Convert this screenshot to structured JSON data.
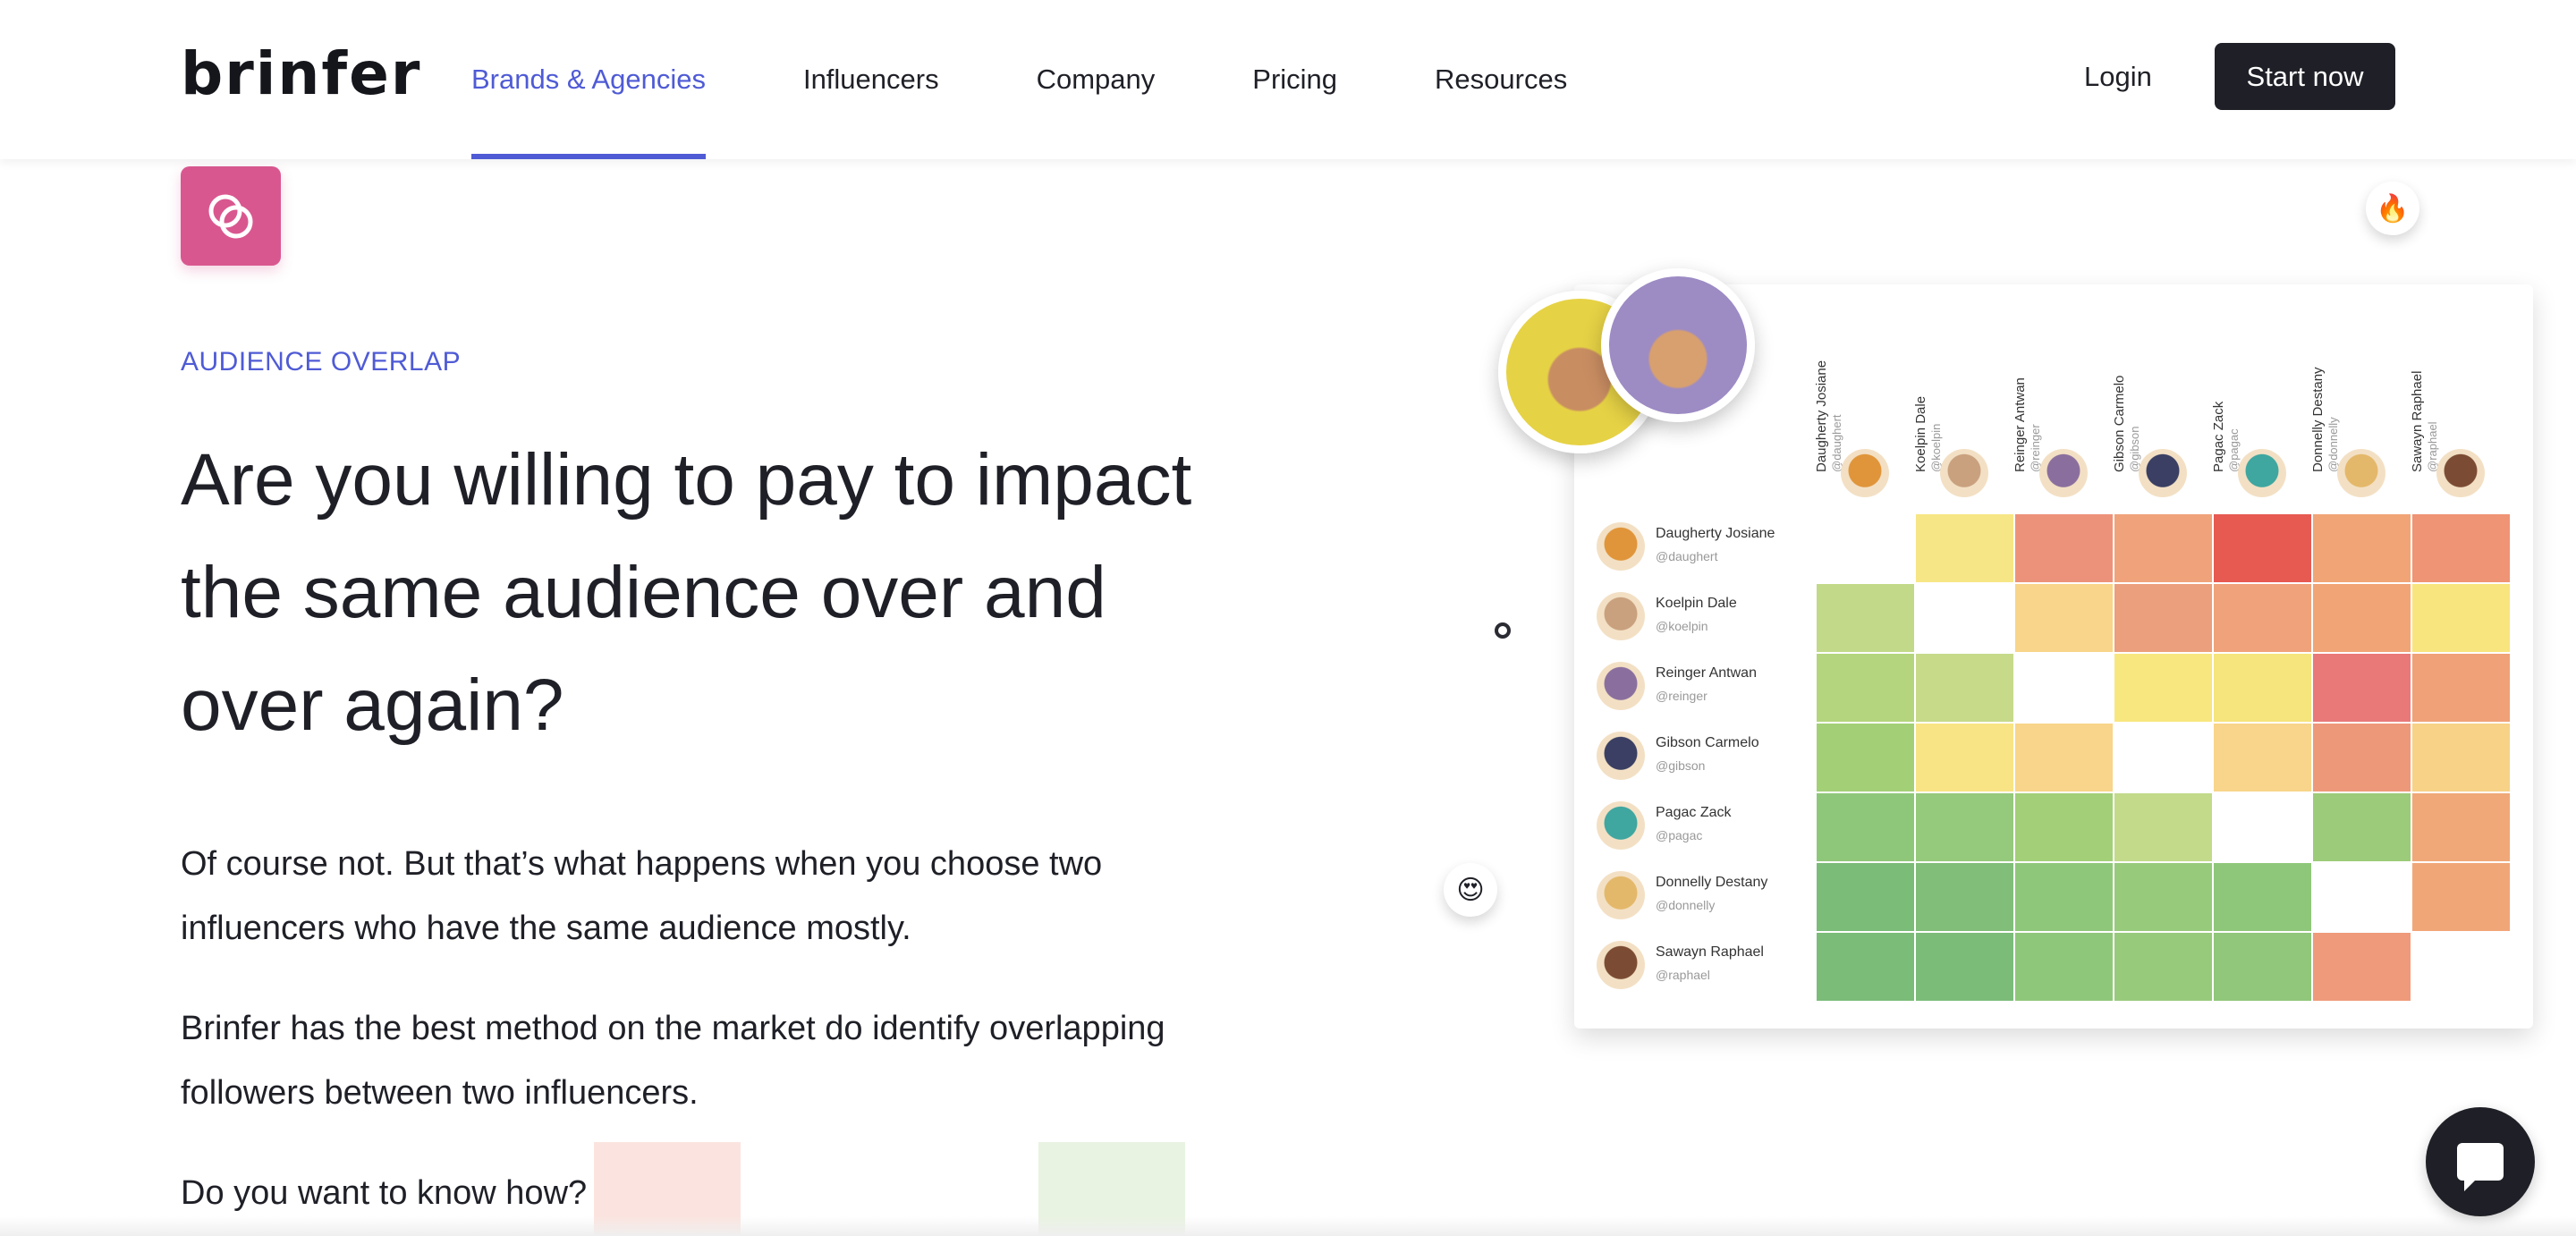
{
  "nav": {
    "logo": "brinfer",
    "links": [
      "Brands & Agencies",
      "Influencers",
      "Company",
      "Pricing",
      "Resources"
    ],
    "active_index": 0,
    "login": "Login",
    "cta": "Start now"
  },
  "hero": {
    "eyebrow": "AUDIENCE OVERLAP",
    "headline": "Are you willing to pay to impact the same audience over and over again?",
    "paragraphs": [
      "Of course not. But that’s what happens when you choose two influencers who have the same audience mostly.",
      "Brinfer has the best method on the market do identify overlapping followers between two influencers.",
      "Do you want to know how?"
    ]
  },
  "matrix": {
    "influencers": [
      {
        "name": "Daugherty Josiane",
        "handle": "@daughert",
        "color": "#e0953a"
      },
      {
        "name": "Koelpin Dale",
        "handle": "@koelpin",
        "color": "#c9a17f"
      },
      {
        "name": "Reinger Antwan",
        "handle": "@reinger",
        "color": "#8a6f9e"
      },
      {
        "name": "Gibson Carmelo",
        "handle": "@gibson",
        "color": "#3a3f63"
      },
      {
        "name": "Pagac Zack",
        "handle": "@pagac",
        "color": "#3fa6a0"
      },
      {
        "name": "Donnelly Destany",
        "handle": "@donnelly",
        "color": "#e4b86a"
      },
      {
        "name": "Sawayn Raphael",
        "handle": "@raphael",
        "color": "#7b4c33"
      }
    ],
    "cells": [
      [
        "#ffffff",
        "#f7e685",
        "#ed927a",
        "#f0a37a",
        "#e65a52",
        "#f1a576",
        "#ef9474"
      ],
      [
        "#c2d98a",
        "#ffffff",
        "#f8d58a",
        "#ec9f7d",
        "#f0a37a",
        "#f1a576",
        "#f8e57e"
      ],
      [
        "#b4d57d",
        "#c6da8a",
        "#ffffff",
        "#f8e77f",
        "#f6e47c",
        "#e97979",
        "#f0a178"
      ],
      [
        "#a3d076",
        "#f8e485",
        "#f8d58a",
        "#ffffff",
        "#f8d58a",
        "#ee987a",
        "#f7d287"
      ],
      [
        "#8fc77a",
        "#95c97b",
        "#a3cf78",
        "#c2da8a",
        "#ffffff",
        "#9ccb79",
        "#f0a878"
      ],
      [
        "#7bbc78",
        "#80be79",
        "#8fc77a",
        "#98ca7c",
        "#8fc77a",
        "#ffffff",
        "#f1a678"
      ],
      [
        "#7bbc78",
        "#7cbc79",
        "#8fc77a",
        "#98ca7c",
        "#90c77a",
        "#ef9a7a",
        "#ffffff"
      ]
    ]
  },
  "icons": {
    "feature": "overlap-circles-icon",
    "fire": "fire-emoji-icon",
    "smile": "heart-eyes-emoji-icon",
    "chat": "chat-icon"
  }
}
